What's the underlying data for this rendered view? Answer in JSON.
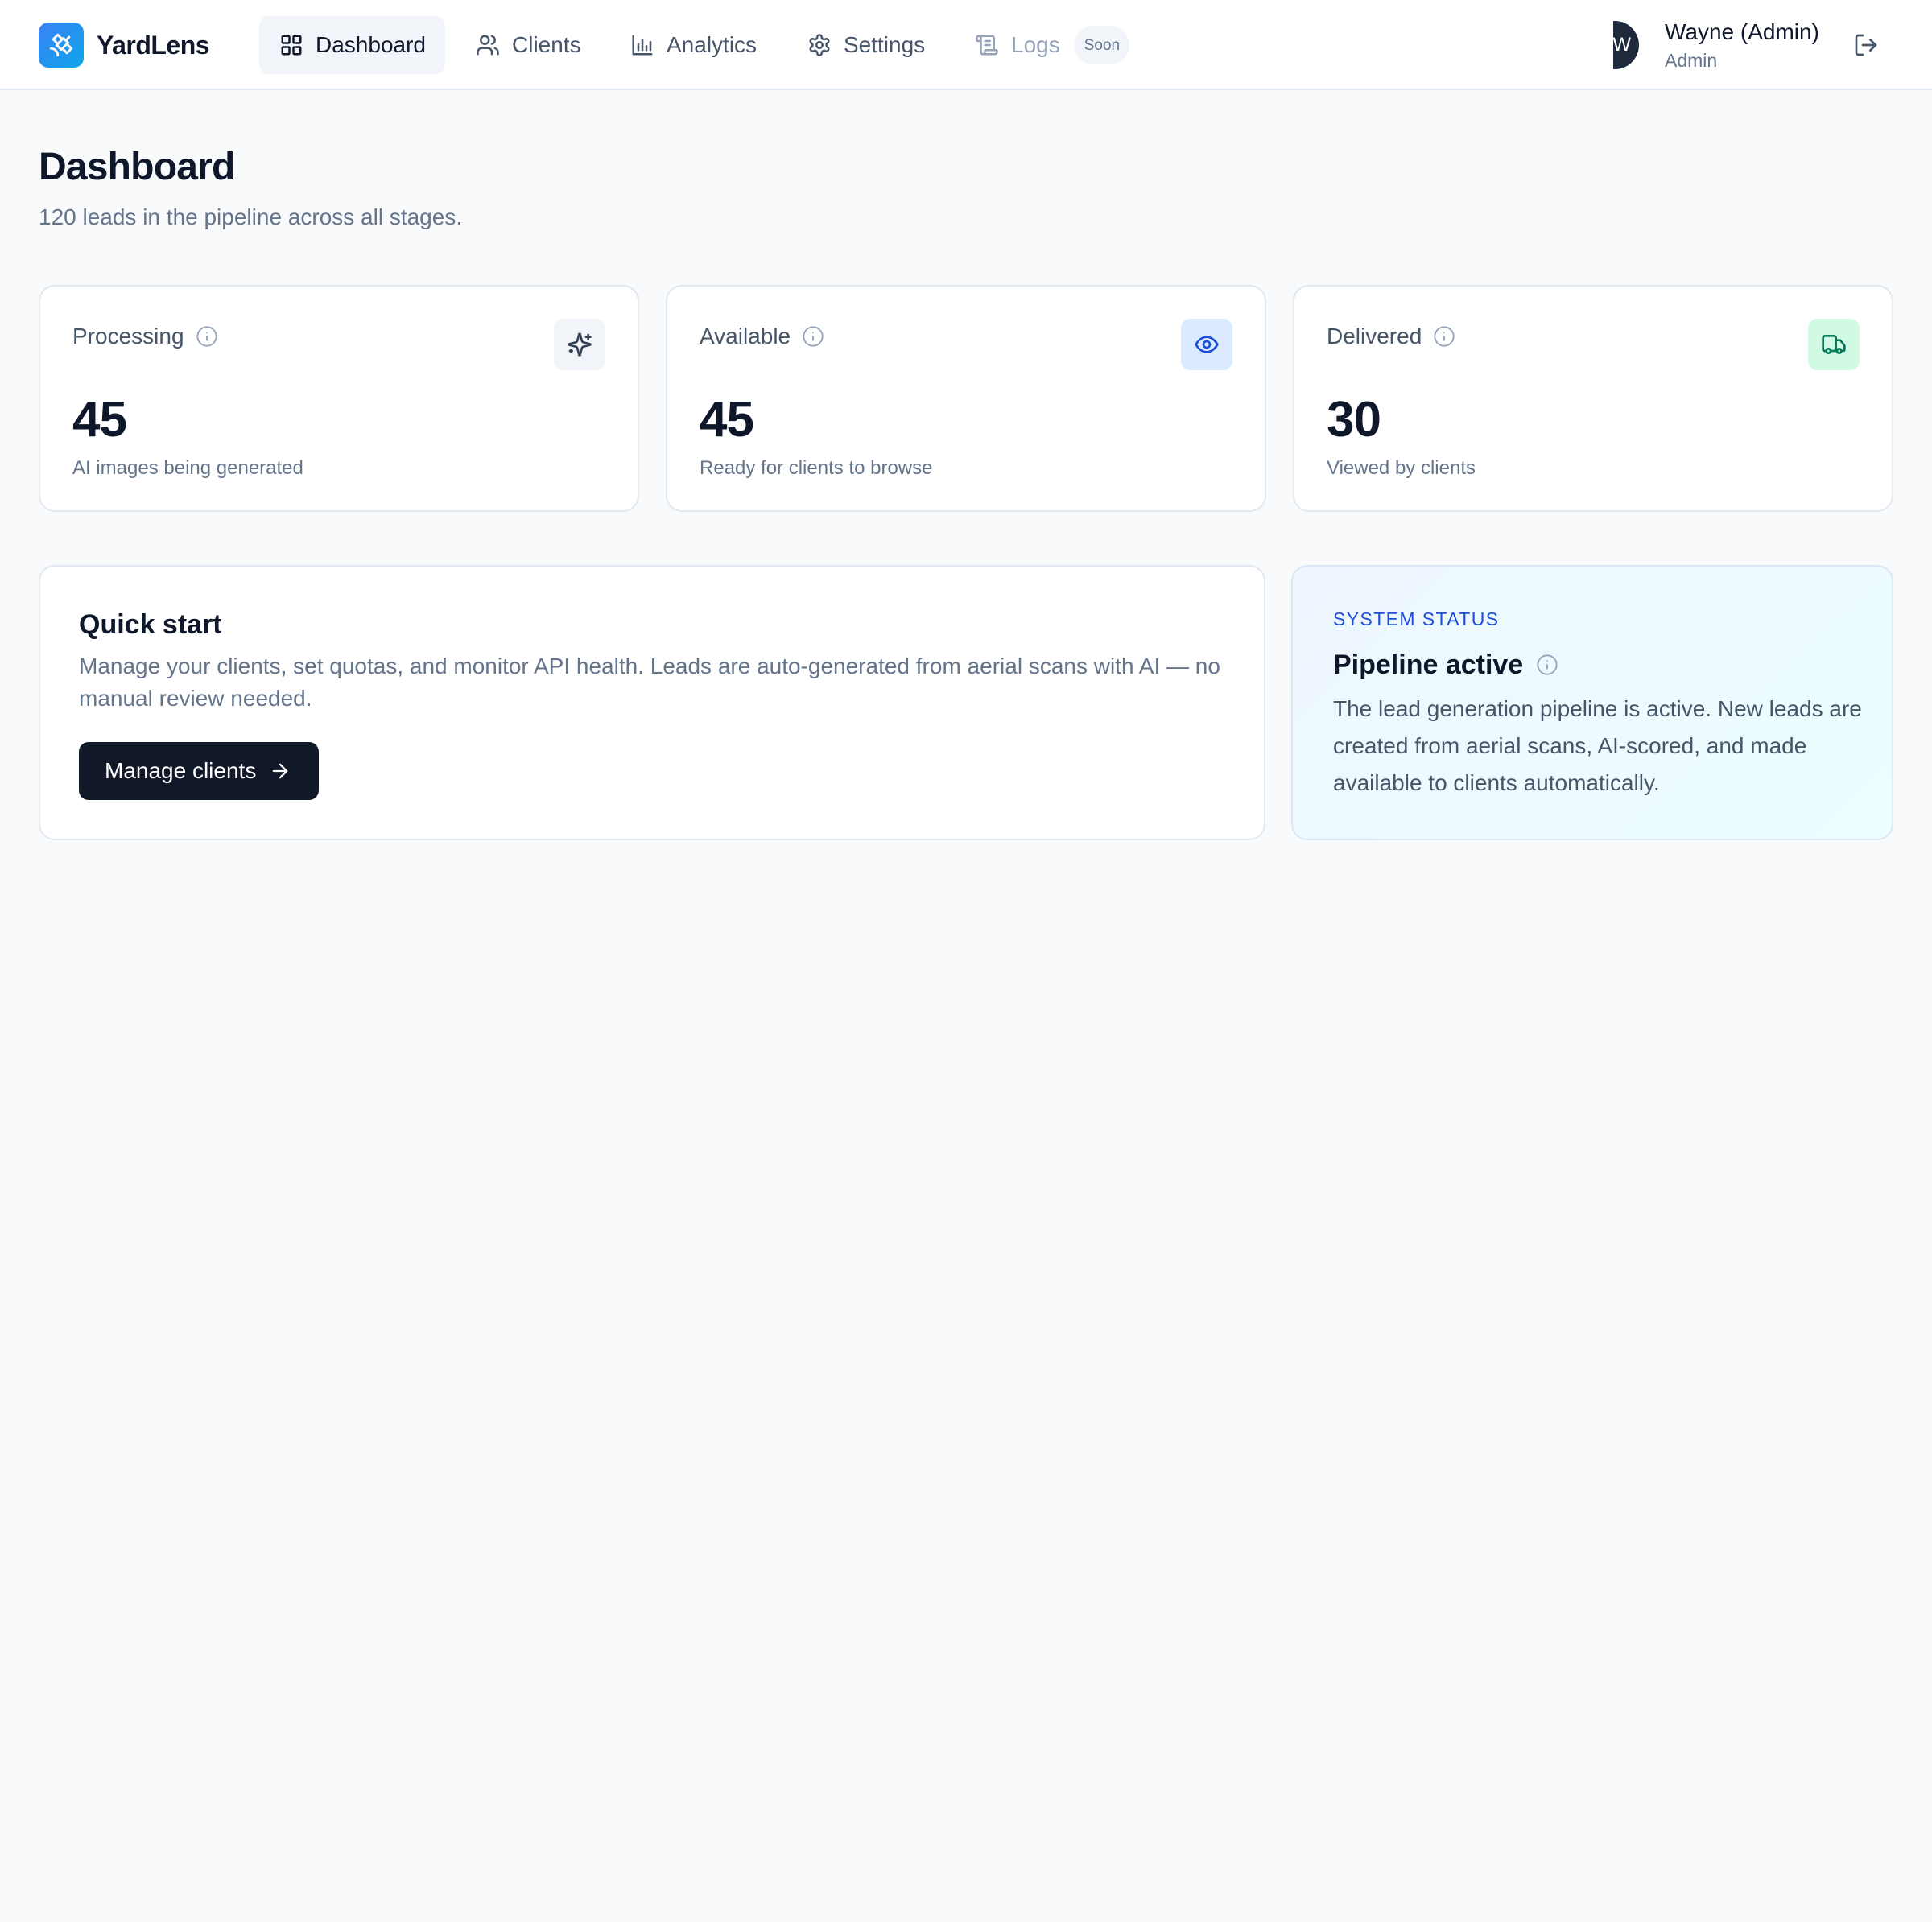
{
  "app": {
    "brand": "YardLens",
    "accent_color": "#3b82f6"
  },
  "nav": {
    "items": [
      {
        "label": "Dashboard",
        "icon": "grid-icon",
        "active": true
      },
      {
        "label": "Clients",
        "icon": "users-icon",
        "active": false
      },
      {
        "label": "Analytics",
        "icon": "bar-chart-icon",
        "active": false
      },
      {
        "label": "Settings",
        "icon": "gear-icon",
        "active": false
      },
      {
        "label": "Logs",
        "icon": "scroll-icon",
        "active": false,
        "disabled": true,
        "badge": "Soon"
      }
    ]
  },
  "user": {
    "avatar_initial": "W",
    "name": "Wayne (Admin)",
    "role": "Admin"
  },
  "header": {
    "title": "Dashboard",
    "subtitle": "120 leads in the pipeline across all stages."
  },
  "stats": [
    {
      "label": "Processing",
      "value": "45",
      "description": "AI images being generated",
      "icon": "sparkles-icon",
      "icon_bg": "#f1f5f9",
      "icon_color": "#334155"
    },
    {
      "label": "Available",
      "value": "45",
      "description": "Ready for clients to browse",
      "icon": "eye-icon",
      "icon_bg": "#dbeafe",
      "icon_color": "#1d4ed8"
    },
    {
      "label": "Delivered",
      "value": "30",
      "description": "Viewed by clients",
      "icon": "truck-icon",
      "icon_bg": "#d1fae5",
      "icon_color": "#047857"
    }
  ],
  "quick_start": {
    "title": "Quick start",
    "text": "Manage your clients, set quotas, and monitor API health. Leads are auto-generated from aerial scans with AI — no manual review needed.",
    "button_label": "Manage clients"
  },
  "system_status": {
    "eyebrow": "SYSTEM STATUS",
    "title": "Pipeline active",
    "text": "The lead generation pipeline is active. New leads are created from aerial scans, AI-scored, and made available to clients automatically."
  }
}
